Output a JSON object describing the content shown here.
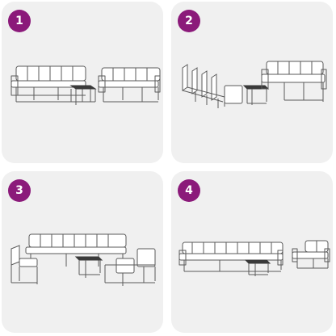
{
  "badge_color": "#8b1a7a",
  "panels": [
    {
      "number": "1",
      "image": "furniture-arrangement-1"
    },
    {
      "number": "2",
      "image": "furniture-arrangement-2"
    },
    {
      "number": "3",
      "image": "furniture-arrangement-3"
    },
    {
      "number": "4",
      "image": "furniture-arrangement-4"
    }
  ]
}
